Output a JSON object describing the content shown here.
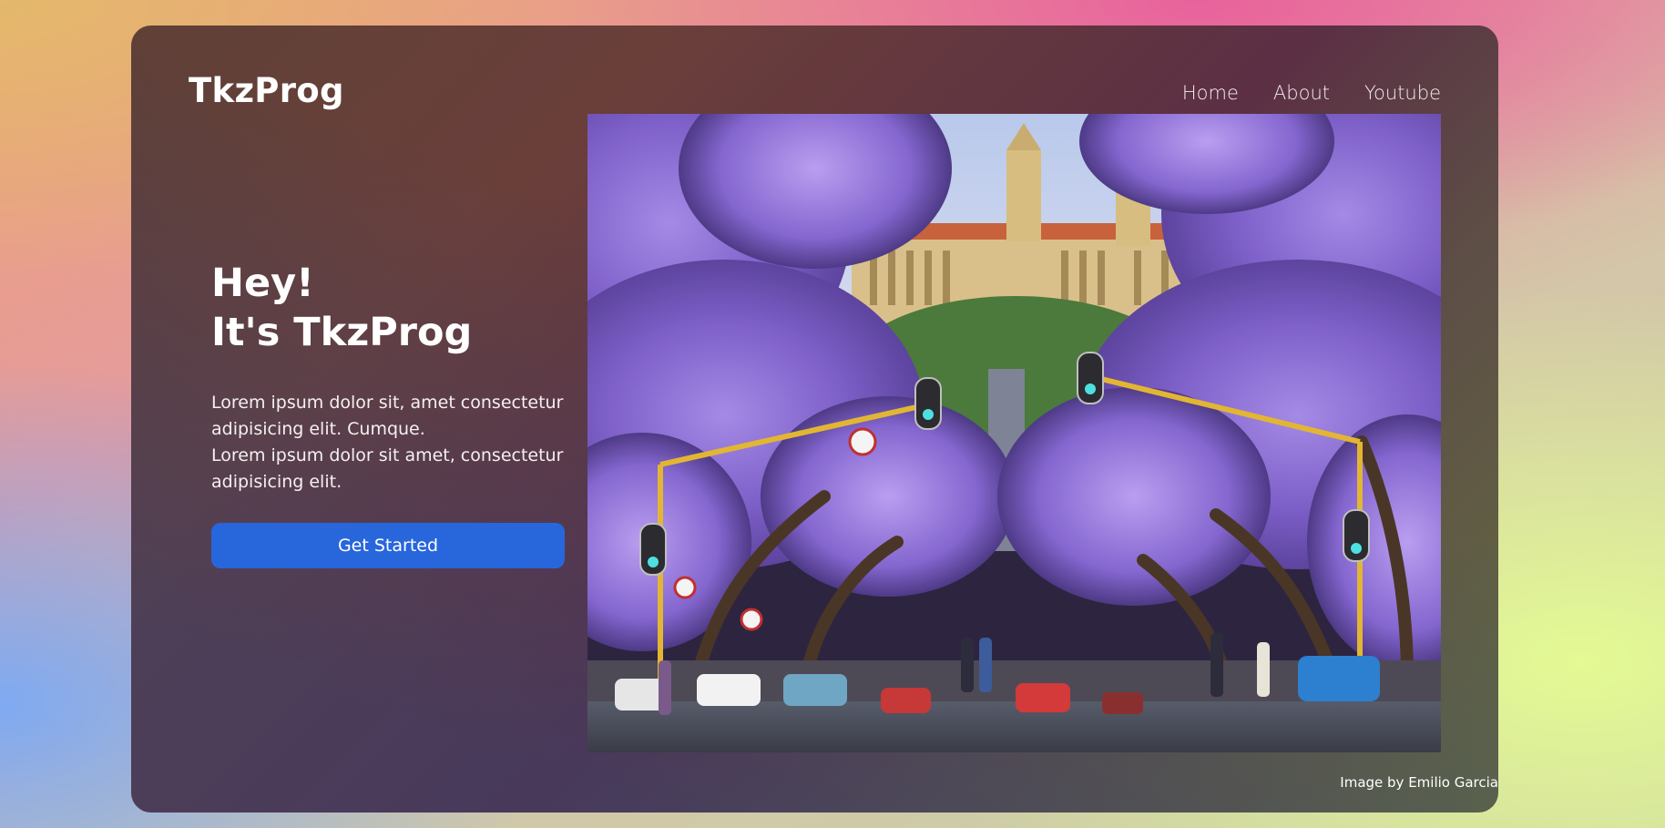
{
  "header": {
    "brand": "TkzProg",
    "nav": [
      "Home",
      "About",
      "Youtube"
    ]
  },
  "hero": {
    "title_line1": "Hey!",
    "title_line2": "It's TkzProg",
    "paragraph_line1": "Lorem ipsum dolor sit, amet consectetur adipisicing elit. Cumque.",
    "paragraph_line2": "Lorem ipsum dolor sit amet, consectetur adipisicing elit.",
    "cta_label": "Get Started"
  },
  "image": {
    "subject": "street-with-jacaranda-trees-and-traffic-lights",
    "credit": "Image by Emilio Garcia"
  },
  "colors": {
    "accent": "#2866dc",
    "text": "#ffffff",
    "blossom": "#8a6ad6"
  }
}
